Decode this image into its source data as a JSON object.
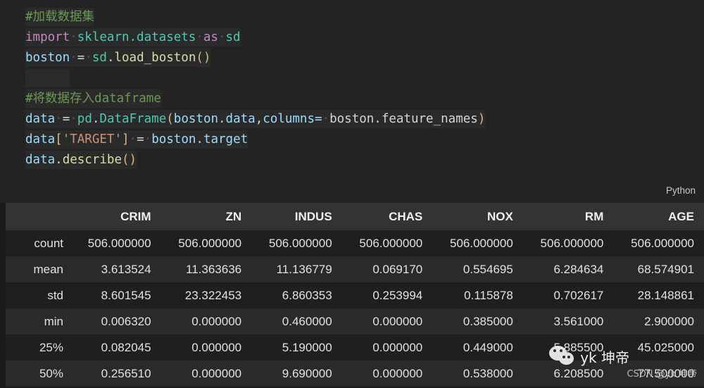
{
  "code_cell": {
    "language_label": "Python",
    "lines": [
      {
        "id": "line1",
        "tokens": [
          {
            "t": "#加载数据集",
            "c": "tok-comment"
          }
        ]
      },
      {
        "id": "line2",
        "tokens": [
          {
            "t": "import",
            "c": "tok-kw"
          },
          {
            "t": "·",
            "c": "dot"
          },
          {
            "t": "sklearn.datasets",
            "c": "tok-mod"
          },
          {
            "t": "·",
            "c": "dot"
          },
          {
            "t": "as",
            "c": "tok-kw"
          },
          {
            "t": "·",
            "c": "dot"
          },
          {
            "t": "sd",
            "c": "tok-mod"
          }
        ]
      },
      {
        "id": "line3",
        "tokens": [
          {
            "t": "boston",
            "c": "tok-var"
          },
          {
            "t": "·",
            "c": "dot"
          },
          {
            "t": "=",
            "c": "tok-op"
          },
          {
            "t": "·",
            "c": "dot"
          },
          {
            "t": "sd",
            "c": "tok-mod"
          },
          {
            "t": ".",
            "c": "tok-punct"
          },
          {
            "t": "load_boston",
            "c": "tok-fn"
          },
          {
            "t": "()",
            "c": "tok-brk"
          }
        ]
      },
      {
        "id": "line4",
        "tokens": []
      },
      {
        "id": "line5",
        "tokens": [
          {
            "t": "#将数据存入dataframe",
            "c": "tok-comment"
          }
        ]
      },
      {
        "id": "line6",
        "tokens": [
          {
            "t": "data",
            "c": "tok-var"
          },
          {
            "t": "·",
            "c": "dot"
          },
          {
            "t": "=",
            "c": "tok-op"
          },
          {
            "t": "·",
            "c": "dot"
          },
          {
            "t": "pd",
            "c": "tok-mod"
          },
          {
            "t": ".",
            "c": "tok-punct"
          },
          {
            "t": "DataFrame",
            "c": "tok-mod"
          },
          {
            "t": "(",
            "c": "tok-brk"
          },
          {
            "t": "boston.data",
            "c": "tok-var"
          },
          {
            "t": ",",
            "c": "tok-punct"
          },
          {
            "t": "columns=",
            "c": "tok-var"
          },
          {
            "t": "·",
            "c": "dot"
          },
          {
            "t": "boston.feature_names",
            "c": "tok-punct"
          },
          {
            "t": ")",
            "c": "tok-brk"
          }
        ]
      },
      {
        "id": "line7",
        "tokens": [
          {
            "t": "data",
            "c": "tok-var"
          },
          {
            "t": "[",
            "c": "tok-brk"
          },
          {
            "t": "'TARGET'",
            "c": "tok-str"
          },
          {
            "t": "]",
            "c": "tok-brk"
          },
          {
            "t": "·",
            "c": "dot"
          },
          {
            "t": "=",
            "c": "tok-op"
          },
          {
            "t": "·",
            "c": "dot"
          },
          {
            "t": "boston.target",
            "c": "tok-var"
          }
        ]
      },
      {
        "id": "line8",
        "tokens": [
          {
            "t": "data",
            "c": "tok-var"
          },
          {
            "t": ".",
            "c": "tok-punct"
          },
          {
            "t": "describe",
            "c": "tok-fn"
          },
          {
            "t": "()",
            "c": "tok-brk"
          }
        ]
      }
    ]
  },
  "output_table": {
    "index_header": "",
    "columns": [
      "CRIM",
      "ZN",
      "INDUS",
      "CHAS",
      "NOX",
      "RM",
      "AGE"
    ],
    "rows": [
      {
        "index": "count",
        "values": [
          "506.000000",
          "506.000000",
          "506.000000",
          "506.000000",
          "506.000000",
          "506.000000",
          "506.000000"
        ]
      },
      {
        "index": "mean",
        "values": [
          "3.613524",
          "11.363636",
          "11.136779",
          "0.069170",
          "0.554695",
          "6.284634",
          "68.574901"
        ]
      },
      {
        "index": "std",
        "values": [
          "8.601545",
          "23.322453",
          "6.860353",
          "0.253994",
          "0.115878",
          "0.702617",
          "28.148861"
        ]
      },
      {
        "index": "min",
        "values": [
          "0.006320",
          "0.000000",
          "0.460000",
          "0.000000",
          "0.385000",
          "3.561000",
          "2.900000"
        ]
      },
      {
        "index": "25%",
        "values": [
          "0.082045",
          "0.000000",
          "5.190000",
          "0.000000",
          "0.449000",
          "5.885500",
          "45.025000"
        ]
      },
      {
        "index": "50%",
        "values": [
          "0.256510",
          "0.000000",
          "9.690000",
          "0.000000",
          "0.538000",
          "6.208500",
          "77.500000"
        ]
      }
    ]
  },
  "watermarks": {
    "wechat_name": "yk 坤帝",
    "csdn": "CSDN @yk 坤帝"
  }
}
